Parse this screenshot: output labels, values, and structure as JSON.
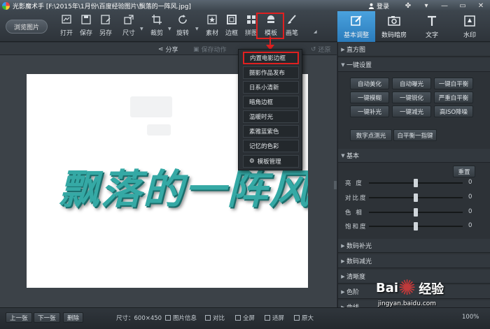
{
  "titlebar": {
    "title": "光影魔术手 [F:\\2015年\\1月份\\百度经验图片\\飘落的一阵风.jpg]",
    "login": "登录"
  },
  "toolbar": {
    "browse": "浏览图片",
    "tools": [
      {
        "label": "打开",
        "icon": "open-icon"
      },
      {
        "label": "保存",
        "icon": "save-icon"
      },
      {
        "label": "另存",
        "icon": "save-as-icon"
      },
      {
        "label": "尺寸",
        "icon": "resize-icon"
      },
      {
        "label": "裁剪",
        "icon": "crop-icon"
      },
      {
        "label": "旋转",
        "icon": "rotate-icon"
      },
      {
        "label": "素材",
        "icon": "material-icon"
      },
      {
        "label": "边框",
        "icon": "border-icon"
      },
      {
        "label": "拼图",
        "icon": "collage-icon"
      },
      {
        "label": "模板",
        "icon": "template-icon"
      },
      {
        "label": "画笔",
        "icon": "brush-icon"
      }
    ]
  },
  "right_tabs": [
    {
      "label": "基本调整",
      "active": true
    },
    {
      "label": "数码暗房",
      "active": false
    },
    {
      "label": "文字",
      "active": false
    },
    {
      "label": "水印",
      "active": false
    }
  ],
  "subbar": {
    "share": "分享",
    "save_action": "保存动作",
    "redo": "还原"
  },
  "template_menu": {
    "items": [
      "内置电影边框",
      "摄影作品发布",
      "日系小清新",
      "暗角边框",
      "温暖时光",
      "素雅蓝紫色",
      "记忆的色彩",
      "模板管理"
    ]
  },
  "canvas": {
    "text_art": "飘落的一阵风"
  },
  "right_panel": {
    "histogram": "直方图",
    "one_click": "一键设置",
    "one_click_buttons": [
      "自动美化",
      "自动曝光",
      "一键白平衡",
      "一键模糊",
      "一键锐化",
      "严重白平衡",
      "一键补光",
      "一键减光",
      "高ISO降噪"
    ],
    "extra_buttons": [
      "数字点测光",
      "白平衡一指键"
    ],
    "basic": "基本",
    "reset": "重置",
    "sliders": [
      {
        "label": "亮 度",
        "value": "0",
        "level": 0.5
      },
      {
        "label": "对比度",
        "value": "0",
        "level": 0.5
      },
      {
        "label": "色 相",
        "value": "0",
        "level": 0.5
      },
      {
        "label": "饱和度",
        "value": "0",
        "level": 0.5
      }
    ],
    "sections": [
      "数码补光",
      "数码减光",
      "清晰度",
      "色阶",
      "曲线"
    ]
  },
  "bottombar": {
    "prev": "上一张",
    "next": "下一张",
    "delete": "删除",
    "size_label": "尺寸：600×450",
    "image_info": "图片信息",
    "compare": "对比",
    "fullscreen": "全屏",
    "fit": "适屏",
    "original": "原大",
    "zoom": "100%"
  },
  "watermark": {
    "brand": "Bai",
    "brand2": "经验",
    "url": "jingyan.baidu.com"
  },
  "colors": {
    "accent": "#2a7bbb",
    "highlight": "#e02020",
    "text_art": "#35a9a5"
  }
}
